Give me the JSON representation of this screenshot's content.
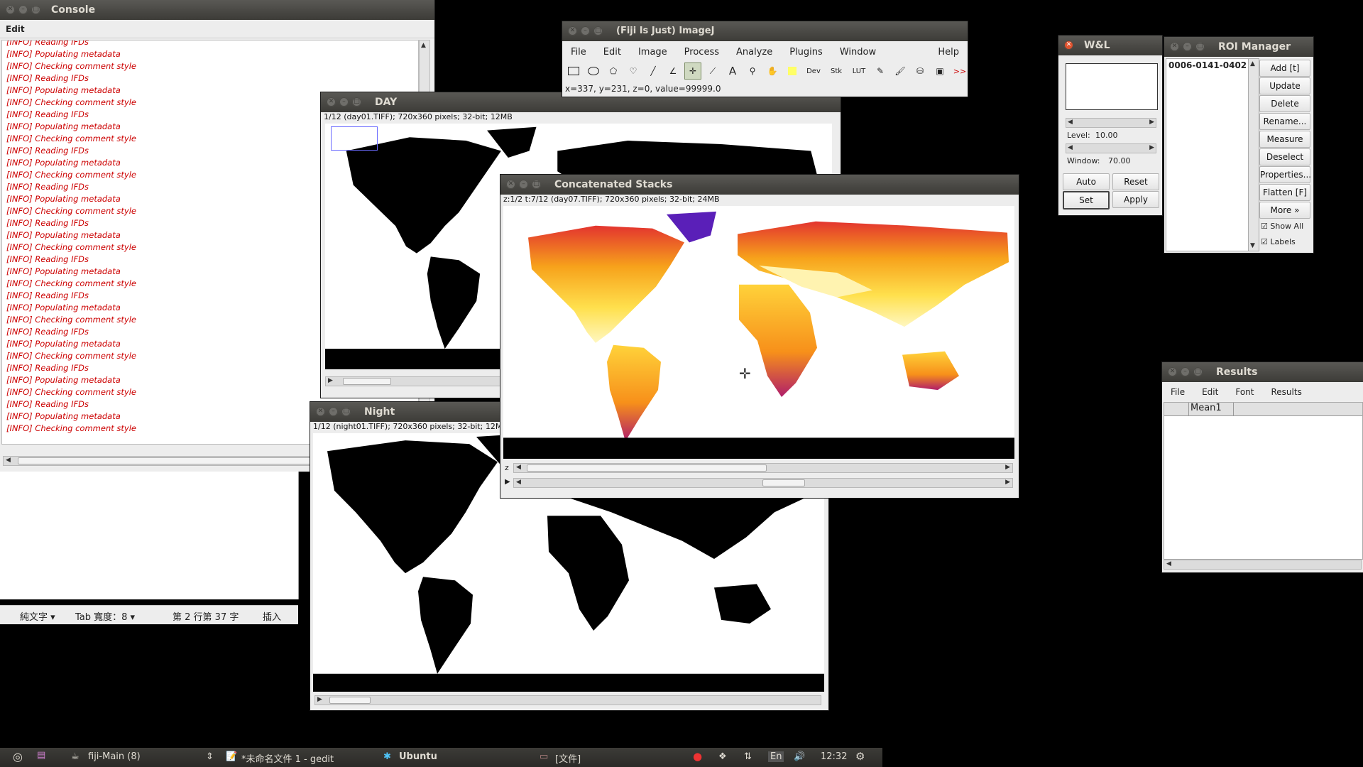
{
  "console": {
    "title": "Console",
    "menu": [
      "Edit"
    ],
    "log": [
      "[INFO] Reading IFDs",
      "[INFO] Populating metadata",
      "[INFO] Checking comment style",
      "[INFO] Reading IFDs",
      "[INFO] Populating metadata",
      "[INFO] Checking comment style",
      "[INFO] Reading IFDs",
      "[INFO] Populating metadata",
      "[INFO] Checking comment style",
      "[INFO] Reading IFDs",
      "[INFO] Populating metadata",
      "[INFO] Checking comment style",
      "[INFO] Reading IFDs",
      "[INFO] Populating metadata",
      "[INFO] Checking comment style",
      "[INFO] Reading IFDs",
      "[INFO] Populating metadata",
      "[INFO] Checking comment style",
      "[INFO] Reading IFDs",
      "[INFO] Populating metadata",
      "[INFO] Checking comment style",
      "[INFO] Reading IFDs",
      "[INFO] Populating metadata",
      "[INFO] Checking comment style",
      "[INFO] Reading IFDs",
      "[INFO] Populating metadata",
      "[INFO] Checking comment style",
      "[INFO] Reading IFDs",
      "[INFO] Populating metadata",
      "[INFO] Checking comment style",
      "[INFO] Reading IFDs",
      "[INFO] Populating metadata",
      "[INFO] Checking comment style"
    ]
  },
  "gedit_status": {
    "mode": "純文字 ▾",
    "tab_width": "Tab 寬度：8 ▾",
    "position": "第 2 行第 37 字",
    "insert": "插入"
  },
  "imagej": {
    "title": "(Fiji Is Just) ImageJ",
    "menus": [
      "File",
      "Edit",
      "Image",
      "Process",
      "Analyze",
      "Plugins",
      "Window"
    ],
    "help": "Help",
    "tools": [
      "rectangle-tool",
      "oval-tool",
      "polygon-tool",
      "freehand-tool",
      "line-tool",
      "angle-tool",
      "point-tool",
      "wand-tool",
      "text-tool",
      "zoom-tool",
      "hand-tool",
      "color-picker-tool",
      "dev-tool",
      "stk-tool",
      "lut-tool",
      "pencil-tool",
      "brush-tool",
      "flood-fill-tool",
      "pixel-inspector-tool",
      "more-tools"
    ],
    "tool_labels": {
      "text": "A",
      "dev": "Dev",
      "stk": "Stk",
      "lut": "LUT",
      "more": ">>"
    },
    "status": "x=337, y=231, z=0, value=99999.0"
  },
  "day": {
    "title": "DAY",
    "info": "1/12 (day01.TIFF); 720x360 pixels; 32-bit; 12MB"
  },
  "night": {
    "title": "Night",
    "info": "1/12 (night01.TIFF); 720x360 pixels; 32-bit; 12MB"
  },
  "concat": {
    "title": "Concatenated Stacks",
    "info": "z:1/2 t:7/12 (day07.TIFF); 720x360 pixels; 32-bit; 24MB",
    "z_label": "z"
  },
  "wl": {
    "title": "W&L",
    "level_label": "Level:",
    "level_value": "10.00",
    "window_label": "Window:",
    "window_value": "70.00",
    "buttons": [
      "Auto",
      "Reset",
      "Set",
      "Apply"
    ]
  },
  "roi": {
    "title": "ROI Manager",
    "items": [
      "0006-0141-0402"
    ],
    "buttons": [
      "Add [t]",
      "Update",
      "Delete",
      "Rename...",
      "Measure",
      "Deselect",
      "Properties...",
      "Flatten [F]",
      "More »"
    ],
    "show_all": "Show All",
    "labels": "Labels"
  },
  "results": {
    "title": "Results",
    "menus": [
      "File",
      "Edit",
      "Font",
      "Results"
    ],
    "columns": [
      "",
      "Mean1"
    ]
  },
  "taskbar": {
    "items": [
      "fiji-Main (8)",
      "*未命名文件 1 - gedit",
      "Ubuntu",
      "[文件]"
    ],
    "lang": "En",
    "clock": "12:32"
  }
}
